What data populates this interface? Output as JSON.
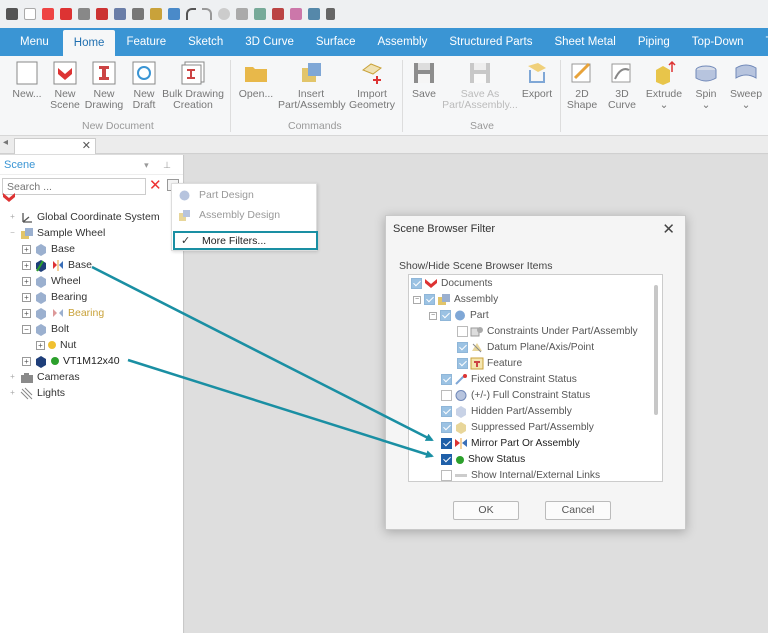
{
  "ribbon_tabs": [
    "Menu",
    "Home",
    "Feature",
    "Sketch",
    "3D Curve",
    "Surface",
    "Assembly",
    "Structured Parts",
    "Sheet Metal",
    "Piping",
    "Top-Down",
    "Too"
  ],
  "active_tab": "Home",
  "ribbon": {
    "new_label": "New...",
    "new_scene_l1": "New",
    "new_scene_l2": "Scene",
    "new_drawing_l1": "New",
    "new_drawing_l2": "Drawing",
    "new_draft_l1": "New",
    "new_draft_l2": "Draft",
    "bulk_l1": "Bulk Drawing",
    "bulk_l2": "Creation",
    "group_new_document": "New Document",
    "open_label": "Open...",
    "insert_l1": "Insert",
    "insert_l2": "Part/Assembly",
    "import_l1": "Import",
    "import_l2": "Geometry",
    "group_commands": "Commands",
    "save_label": "Save",
    "save_as_l1": "Save As",
    "save_as_l2": "Part/Assembly...",
    "export_label": "Export",
    "group_save": "Save",
    "shape2d_l1": "2D",
    "shape2d_l2": "Shape",
    "curve3d_l1": "3D",
    "curve3d_l2": "Curve",
    "extrude_label": "Extrude",
    "spin_label": "Spin",
    "sweep_label": "Sweep"
  },
  "scene_panel": {
    "title": "Scene",
    "search_placeholder": "Search ...",
    "tree": [
      {
        "label": "Global Coordinate System"
      },
      {
        "label": "Sample Wheel"
      },
      {
        "label": "Base"
      },
      {
        "label": "Base"
      },
      {
        "label": "Wheel"
      },
      {
        "label": "Bearing"
      },
      {
        "label": "Bearing"
      },
      {
        "label": "Bolt"
      },
      {
        "label": "Nut"
      },
      {
        "label": "VT1M12x40"
      },
      {
        "label": "Cameras"
      },
      {
        "label": "Lights"
      }
    ]
  },
  "filter_menu": {
    "items": [
      "Part Design",
      "Assembly Design",
      "More Filters..."
    ]
  },
  "dialog": {
    "title": "Scene Browser Filter",
    "subtitle": "Show/Hide Scene Browser Items",
    "items": [
      "Documents",
      "Assembly",
      "Part",
      "Constraints Under Part/Assembly",
      "Datum Plane/Axis/Point",
      "Feature",
      "Fixed Constraint Status",
      "(+/-) Full Constraint Status",
      "Hidden Part/Assembly",
      "Suppressed Part/Assembly",
      "Mirror Part Or Assembly",
      "Show Status",
      "Show Internal/External Links"
    ],
    "ok_label": "OK",
    "cancel_label": "Cancel"
  },
  "colors": {
    "ribbon_blue": "#3a95d4",
    "highlight_teal": "#1a8fa3",
    "status_green": "#2ca02c",
    "nut_yellow": "#f0c030"
  }
}
